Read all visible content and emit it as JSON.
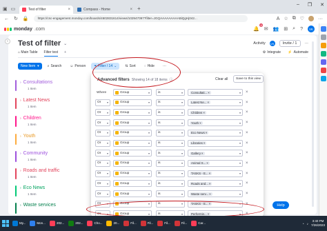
{
  "browser": {
    "tabs": [
      {
        "title": "Test of filter",
        "active": true
      },
      {
        "title": "Compass - Home",
        "active": false
      }
    ],
    "new_tab": "+",
    "url": "https://csc-engagement.monday.com/boards/4602831614/views/102947097?filter=JGQAAAAAAAAABiQgHj042...",
    "window_controls": [
      "–",
      "❐",
      "✕"
    ]
  },
  "monday": {
    "logo_main": "monday",
    "logo_suffix": ".com",
    "notifications_count": "8",
    "user_initials": "VK"
  },
  "board": {
    "title": "Test of filter",
    "activity_label": "Activity",
    "activity_initials": "VK",
    "invite_label": "Invite / 1",
    "tabs": [
      "Main Table",
      "Filter test"
    ],
    "add_tab": "+",
    "integrate_label": "Integrate",
    "automate_label": "Automate"
  },
  "toolbar": {
    "new_item": "New Item",
    "search": "Search",
    "person": "Person",
    "filter": "Filter / 14",
    "sort": "Sort",
    "hide": "Hide",
    "more": "···"
  },
  "groups": [
    {
      "name": "Consultations",
      "count": "1 Item",
      "color": "#a25ddc"
    },
    {
      "name": "Latest News",
      "count": "1 Item",
      "color": "#e2445c"
    },
    {
      "name": "Children",
      "count": "1 Item",
      "color": "#ff158a"
    },
    {
      "name": "Youth",
      "count": "1 Item",
      "color": "#fdab3d"
    },
    {
      "name": "Community",
      "count": "1 Item",
      "color": "#9d50dd"
    },
    {
      "name": "Roads and traffic",
      "count": "1 Item",
      "color": "#e2445c"
    },
    {
      "name": "Eco News",
      "count": "1 Item",
      "color": "#00c875"
    },
    {
      "name": "Waste services",
      "count": "",
      "color": "#037f4c"
    }
  ],
  "filter_panel": {
    "title": "Advanced filters",
    "subtitle": "Showing 14 of 18 items",
    "clear_all": "Clear all",
    "save_view": "Save to this view",
    "rows": [
      {
        "cond": "Where",
        "column": "Group",
        "op": "is",
        "value": "Consultati..."
      },
      {
        "cond": "Or",
        "column": "Group",
        "op": "is",
        "value": "Latest Ne..."
      },
      {
        "cond": "Or",
        "column": "Group",
        "op": "is",
        "value": "Children"
      },
      {
        "cond": "Or",
        "column": "Group",
        "op": "is",
        "value": "Youth"
      },
      {
        "cond": "Or",
        "column": "Group",
        "op": "is",
        "value": "Eco News"
      },
      {
        "cond": "Or",
        "column": "Group",
        "op": "is",
        "value": "Libraries"
      },
      {
        "cond": "Or",
        "column": "Group",
        "op": "is",
        "value": "Gallery"
      },
      {
        "cond": "Or",
        "column": "Group",
        "op": "is",
        "value": "Animal S..."
      },
      {
        "cond": "Or",
        "column": "Group",
        "op": "is",
        "value": "TASKS - E..."
      },
      {
        "cond": "Or",
        "column": "Group",
        "op": "is",
        "value": "Roads and..."
      },
      {
        "cond": "Or",
        "column": "Group",
        "op": "is",
        "value": "Waste serv..."
      },
      {
        "cond": "Or",
        "column": "Group",
        "op": "is",
        "value": "TASKS - E..."
      },
      {
        "cond": "Or",
        "column": "Group",
        "op": "is",
        "value": "Performin..."
      }
    ]
  },
  "help_label": "Help",
  "taskbar": {
    "items": [
      "My...",
      "Mon...",
      "202...",
      "202...",
      "Cho...",
      "20...",
      "Fil...",
      "Fil...",
      "Fil...",
      "Fil...",
      "Car..."
    ],
    "time": "3:40 PM",
    "date": "7/26/2023"
  }
}
